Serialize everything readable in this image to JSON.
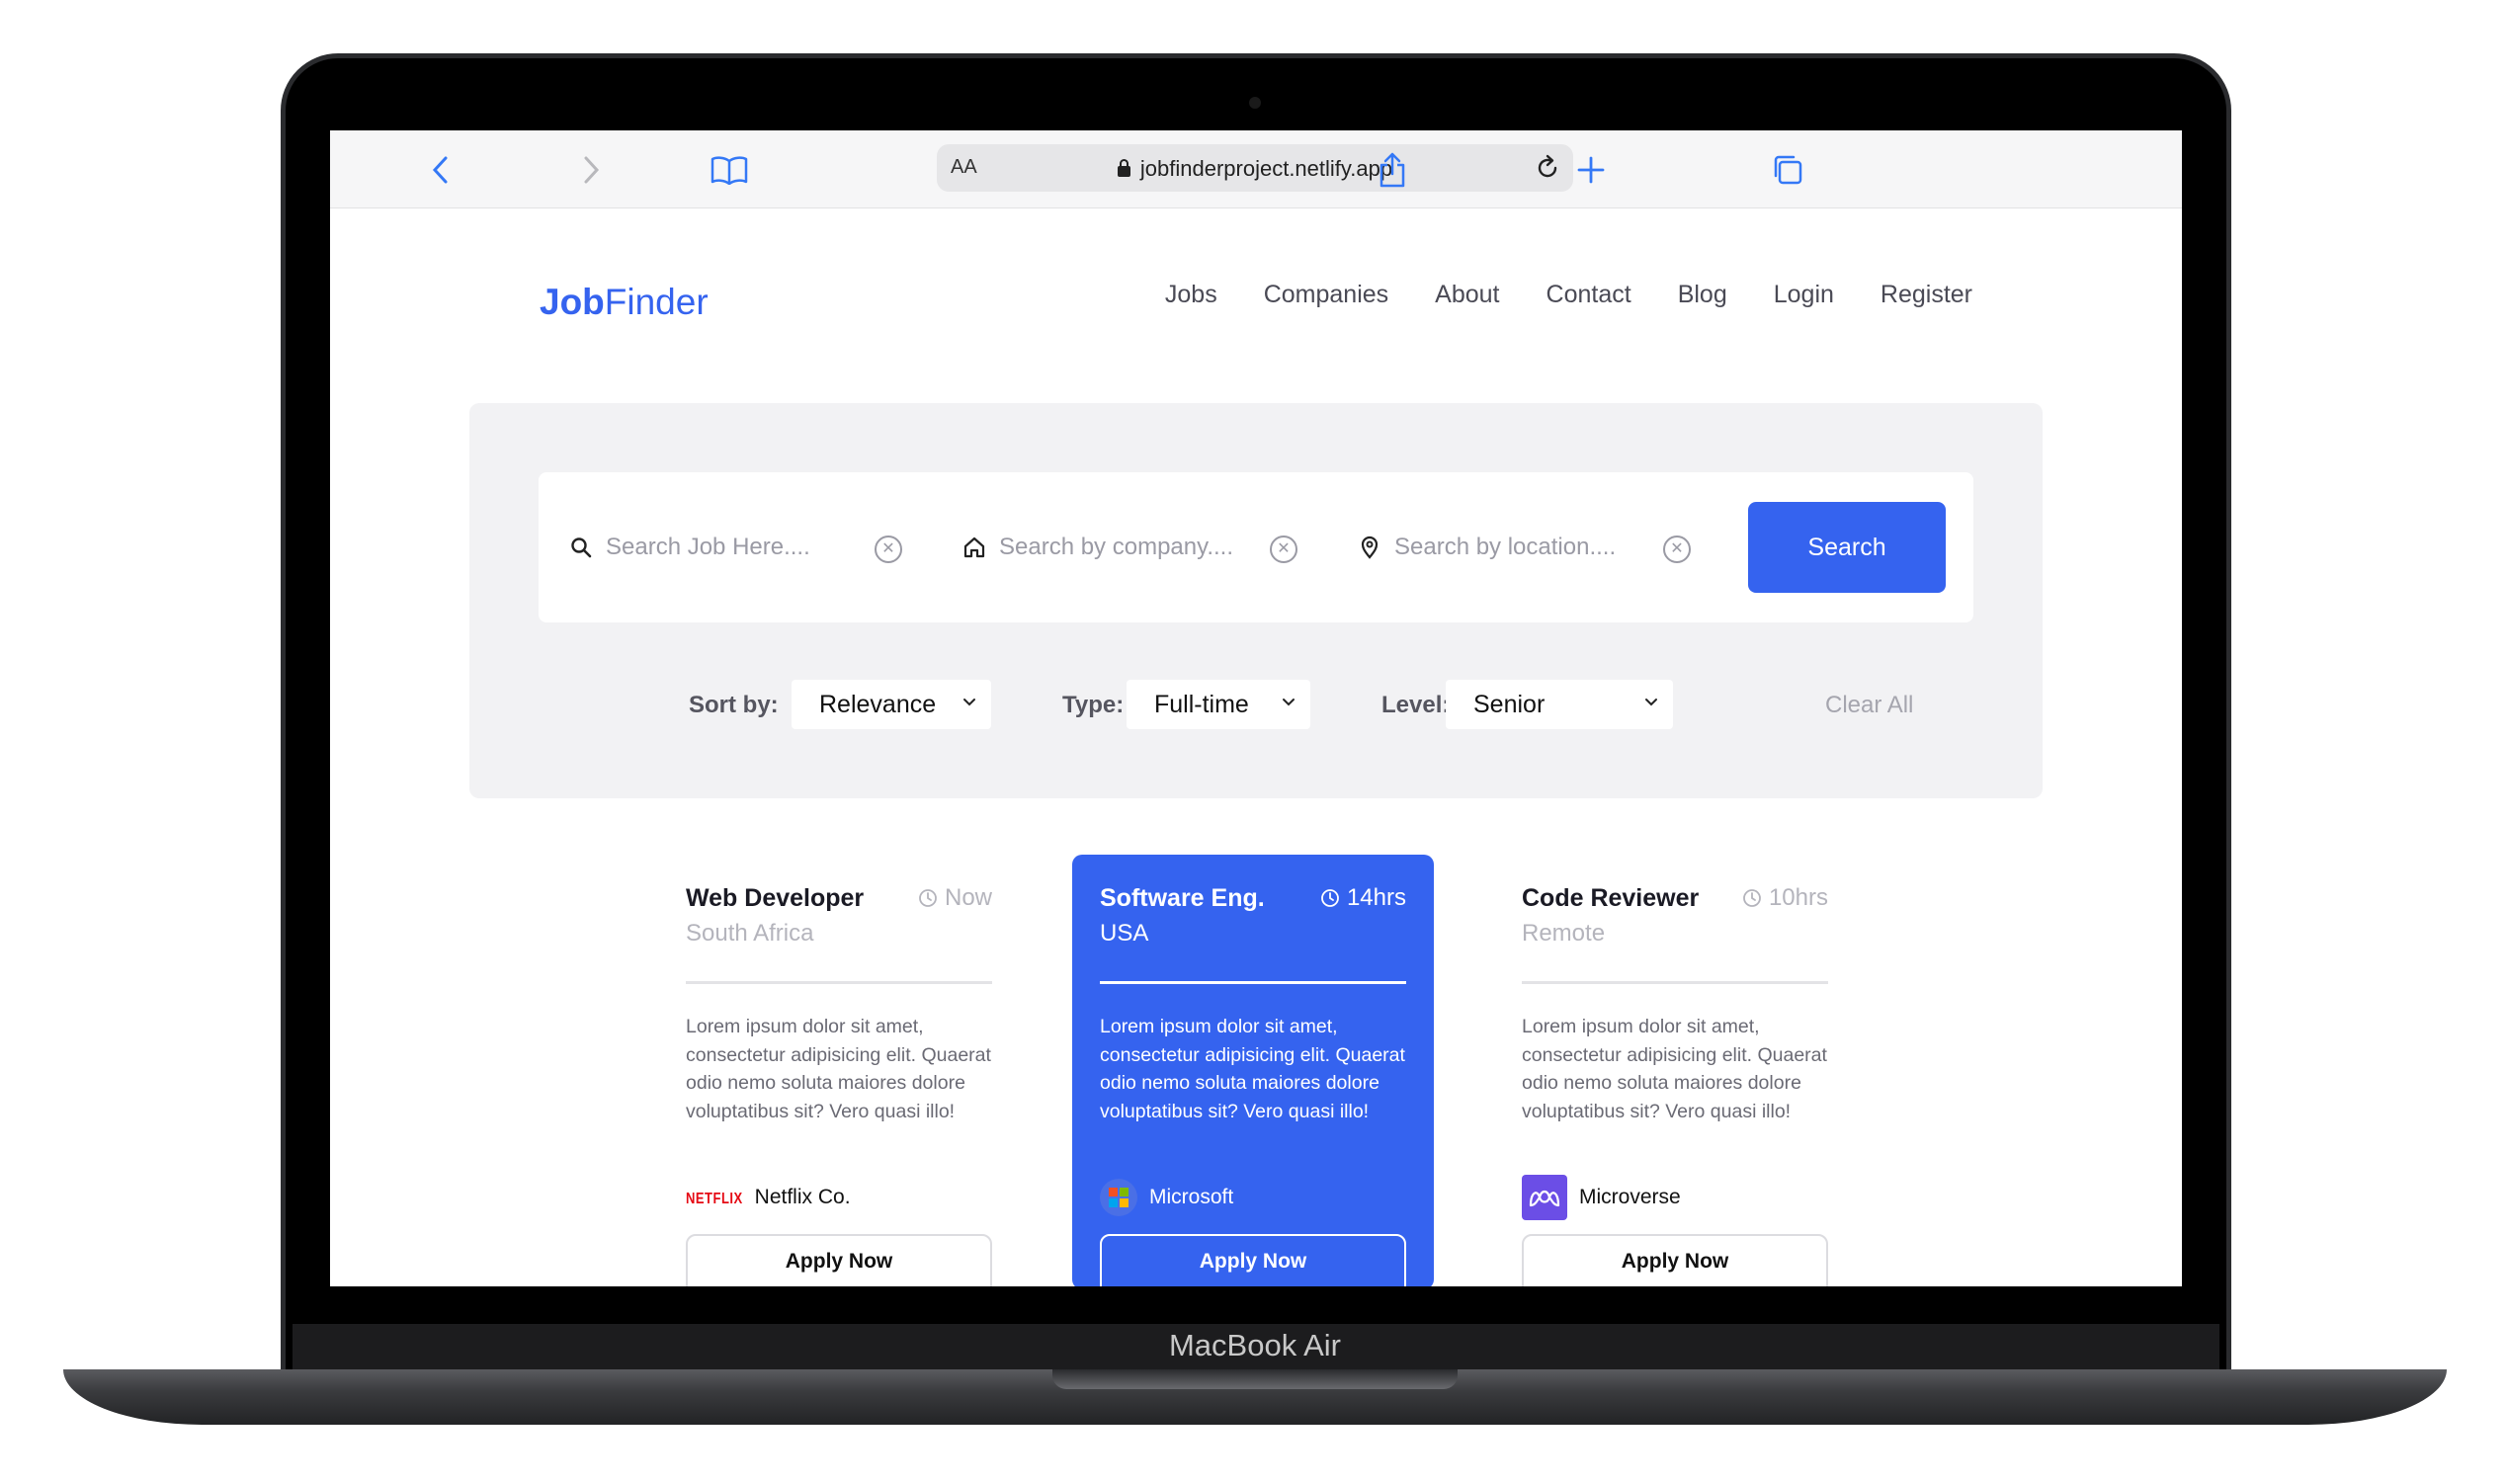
{
  "device": {
    "label": "MacBook Air"
  },
  "browser": {
    "text_size_label": "AA",
    "url": "jobfinderproject.netlify.app"
  },
  "brand": {
    "bold": "Job",
    "light": "Finder",
    "color": "#3563ef"
  },
  "nav": [
    "Jobs",
    "Companies",
    "About",
    "Contact",
    "Blog",
    "Login",
    "Register"
  ],
  "search": {
    "job_placeholder": "Search Job Here....",
    "company_placeholder": "Search by company....",
    "location_placeholder": "Search by location....",
    "button_label": "Search"
  },
  "filters": {
    "sort_label": "Sort by:",
    "sort_value": "Relevance",
    "type_label": "Type:",
    "type_value": "Full-time",
    "level_label": "Level:",
    "level_value": "Senior",
    "clear_label": "Clear All"
  },
  "cards": [
    {
      "title": "Web Developer",
      "time": "Now",
      "location": "South Africa",
      "description": "Lorem ipsum dolor sit amet, consectetur adipisicing elit. Quaerat odio nemo soluta maiores dolore voluptatibus sit? Vero quasi illo!",
      "logo_text": "NETFLIX",
      "company": "Netflix Co.",
      "apply_label": "Apply Now"
    },
    {
      "title": "Software Eng.",
      "time": "14hrs",
      "location": "USA",
      "description": "Lorem ipsum dolor sit amet, consectetur adipisicing elit. Quaerat odio nemo soluta maiores dolore voluptatibus sit? Vero quasi illo!",
      "company": "Microsoft",
      "apply_label": "Apply Now"
    },
    {
      "title": "Code Reviewer",
      "time": "10hrs",
      "location": "Remote",
      "description": "Lorem ipsum dolor sit amet, consectetur adipisicing elit. Quaerat odio nemo soluta maiores dolore voluptatibus sit? Vero quasi illo!",
      "company": "Microverse",
      "apply_label": "Apply Now"
    }
  ]
}
